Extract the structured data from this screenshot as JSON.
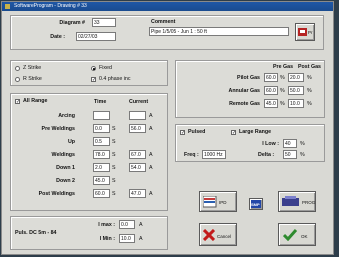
{
  "window": {
    "title": "SoftwareProgram - Drawing # 33"
  },
  "header": {
    "diagram_label": "Diagram #",
    "diagram_value": "33",
    "date_label": "Date :",
    "date_value": "02/27/03",
    "comment_label": "Comment",
    "comment_value": "Pipe 1/5/05 - Jun 1 : 50 ft",
    "print_label": "Pr"
  },
  "mode": {
    "options": [
      {
        "label": "Z Strike",
        "selected": false
      },
      {
        "label": "Fixed",
        "selected": true
      },
      {
        "label": "R Strike",
        "selected": false
      },
      {
        "label": "0.4 phase inc",
        "selected": true
      }
    ]
  },
  "pressure": {
    "col_pre": "Pre Gas",
    "col_post": "Post Gas",
    "rows": [
      {
        "label": "Pilot Gas",
        "pre": "60.0",
        "pre_unit": "%",
        "post": "20.0",
        "post_unit": "%"
      },
      {
        "label": "Annular Gas",
        "pre": "60.0",
        "pre_unit": "%",
        "post": "50.0",
        "post_unit": "%"
      },
      {
        "label": "Remote Gas",
        "pre": "45.0",
        "pre_unit": "%",
        "post": "10.0",
        "post_unit": "%"
      }
    ]
  },
  "range": {
    "all_range_label": "All Range",
    "col_time": "Time",
    "col_current": "Current",
    "rows": [
      {
        "label": "Arcing",
        "time": "",
        "t_unit": "",
        "current": "",
        "c_unit": "A"
      },
      {
        "label": "Pre Weldings",
        "time": "0.0",
        "t_unit": "S",
        "current": "56.0",
        "c_unit": "A"
      },
      {
        "label": "Up",
        "time": "0.5",
        "t_unit": "S",
        "current": "",
        "c_unit": ""
      },
      {
        "label": "Weldings",
        "time": "78.0",
        "t_unit": "S",
        "current": "67.0",
        "c_unit": "A"
      },
      {
        "label": "Down 1",
        "time": "2.0",
        "t_unit": "S",
        "current": "54.0",
        "c_unit": "A"
      },
      {
        "label": "Down 2",
        "time": "45.0",
        "t_unit": "S",
        "current": "",
        "c_unit": ""
      },
      {
        "label": "Post Weldings",
        "time": "60.0",
        "t_unit": "S",
        "current": "47.0",
        "c_unit": "A"
      }
    ]
  },
  "footer_left": {
    "label": "Puls. DC 5m - 84",
    "imax_label": "I max :",
    "imax_value": "0.0",
    "imax_unit": "A",
    "imin_label": "I Min :",
    "imin_value": "10.0",
    "imin_unit": "A"
  },
  "pulse": {
    "pulsed_label": "Pulsed",
    "large_label": "Large Range",
    "ilow_label": "I Low :",
    "ilow_value": "40",
    "ilow_unit": "%",
    "freq_label": "Freq :",
    "freq_value": "1000 Hz",
    "delta_label": "Delta :",
    "delta_value": "50",
    "delta_unit": "%"
  },
  "actions": {
    "save_label": "IPD",
    "mid_label": "SMP",
    "cancel_label": "Cancel",
    "right_label": "PROG",
    "ok_label": "OK"
  },
  "colors": {
    "title_bar": "#1f57a6",
    "panel": "#dcdcd7",
    "cancel_red": "#c21a1a",
    "ok_green": "#2e8a2e"
  }
}
